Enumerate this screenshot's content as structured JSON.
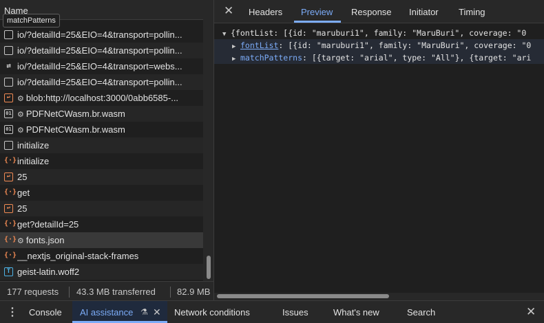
{
  "left_panel": {
    "column_header": "Name",
    "tooltip": "matchPatterns",
    "requests": [
      {
        "icon": "document-icon",
        "glyph": "",
        "text": "io/?detailId=25&EIO=4&transport=pollin...",
        "gear": false
      },
      {
        "icon": "document-icon",
        "glyph": "",
        "text": "io/?detailId=25&EIO=4&transport=pollin...",
        "gear": false
      },
      {
        "icon": "websocket-icon",
        "glyph": "⇄",
        "text": "io/?detailId=25&EIO=4&transport=webs...",
        "gear": false
      },
      {
        "icon": "document-icon",
        "glyph": "",
        "text": "io/?detailId=25&EIO=4&transport=pollin...",
        "gear": false
      },
      {
        "icon": "fetch-icon",
        "glyph": "↩",
        "text": "blob:http://localhost:3000/0abb6585-...",
        "gear": true
      },
      {
        "icon": "wasm-icon",
        "glyph": "01",
        "text": "PDFNetCWasm.br.wasm",
        "gear": true
      },
      {
        "icon": "wasm-icon",
        "glyph": "01",
        "text": "PDFNetCWasm.br.wasm",
        "gear": true
      },
      {
        "icon": "document-icon",
        "glyph": "",
        "text": "initialize",
        "gear": false
      },
      {
        "icon": "json-icon",
        "glyph": "{·}",
        "text": "initialize",
        "gear": false
      },
      {
        "icon": "fetch-icon",
        "glyph": "↩",
        "text": "25",
        "gear": false
      },
      {
        "icon": "json-icon",
        "glyph": "{·}",
        "text": "get",
        "gear": false
      },
      {
        "icon": "fetch-icon",
        "glyph": "↩",
        "text": "25",
        "gear": false
      },
      {
        "icon": "json-icon",
        "glyph": "{·}",
        "text": "get?detailId=25",
        "gear": false
      },
      {
        "icon": "json-icon",
        "glyph": "{·}",
        "text": "fonts.json",
        "gear": true,
        "selected": true
      },
      {
        "icon": "json-icon",
        "glyph": "{·}",
        "text": "__nextjs_original-stack-frames",
        "gear": false
      },
      {
        "icon": "font-file-icon",
        "glyph": "T",
        "text": "geist-latin.woff2",
        "gear": false
      }
    ]
  },
  "status_bar": {
    "requests": "177 requests",
    "transferred": "43.3 MB transferred",
    "resources": "82.9 MB"
  },
  "detail_tabs": {
    "headers": "Headers",
    "preview": "Preview",
    "response": "Response",
    "initiator": "Initiator",
    "timing": "Timing"
  },
  "preview": {
    "root": "{fontList: [{id: \"maruburi1\", family: \"MaruBuri\", coverage: \"0",
    "font_list_key": "fontList",
    "font_list_value": ": [{id: \"maruburi1\", family: \"MaruBuri\", coverage: \"0",
    "match_patterns_key": "matchPatterns",
    "match_patterns_value": ": [{target: \"arial\", type: \"All\"}, {target: \"ari"
  },
  "drawer": {
    "console": "Console",
    "ai_assistance": "AI assistance",
    "network_conditions": "Network conditions",
    "issues": "Issues",
    "whats_new": "What's new",
    "search": "Search"
  }
}
